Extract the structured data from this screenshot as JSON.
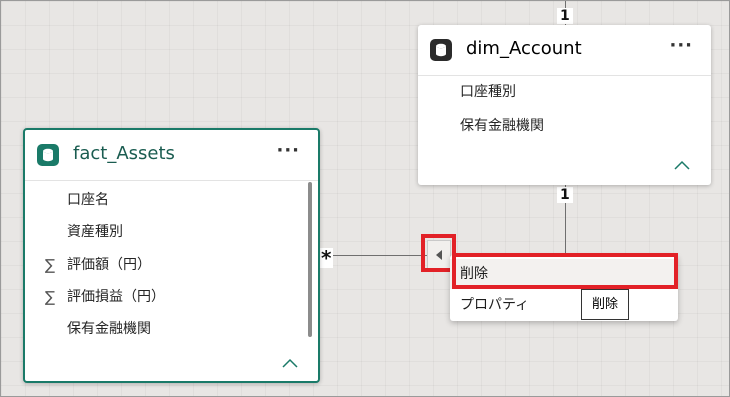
{
  "colors": {
    "fact_accent": "#1a7a68",
    "highlight": "#e22127",
    "icon_dark": "#2b2b2b"
  },
  "relationship": {
    "one_top": "1",
    "one_mid": "1",
    "many": "*"
  },
  "fact_table": {
    "title": "fact_Assets",
    "more": "···",
    "icon": "database-icon",
    "fields": [
      {
        "label": "口座名",
        "aggregate": ""
      },
      {
        "label": "資産種別",
        "aggregate": ""
      },
      {
        "label": "評価額（円）",
        "aggregate": "∑"
      },
      {
        "label": "評価損益（円）",
        "aggregate": "∑"
      },
      {
        "label": "保有金融機関",
        "aggregate": ""
      }
    ]
  },
  "dim_table": {
    "title": "dim_Account",
    "more": "···",
    "icon": "database-icon",
    "fields": [
      {
        "label": "口座種別"
      },
      {
        "label": "保有金融機関"
      }
    ]
  },
  "context_menu": {
    "items": [
      {
        "label": "削除"
      },
      {
        "label": "プロパティ"
      }
    ],
    "tooltip": "削除"
  }
}
